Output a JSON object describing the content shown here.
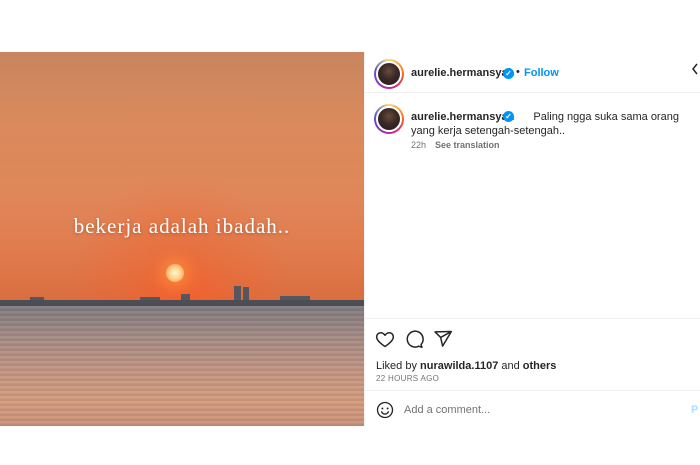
{
  "photo": {
    "overlay_text": "bekerja adalah ibadah.."
  },
  "header": {
    "username": "aurelie.hermansyah",
    "verified": "✓",
    "separator": "•",
    "follow_label": "Follow",
    "more_label": "‹"
  },
  "caption": {
    "username": "aurelie.hermansyah",
    "verified": "✓",
    "text": "Paling ngga suka sama orang yang kerja setengah-setengah..",
    "time": "22h",
    "see_translation": "See translation"
  },
  "actions": {
    "icons": [
      "heart-icon",
      "comment-icon",
      "share-icon"
    ],
    "liked_prefix": "Liked by",
    "liked_user": "nurawilda.1107",
    "liked_and": "and",
    "liked_others": "others",
    "timestamp": "22 HOURS AGO"
  },
  "comment": {
    "placeholder": "Add a comment...",
    "post_label": "P"
  },
  "colors": {
    "accent": "#0095f6",
    "text": "#262626",
    "muted": "#737373"
  }
}
